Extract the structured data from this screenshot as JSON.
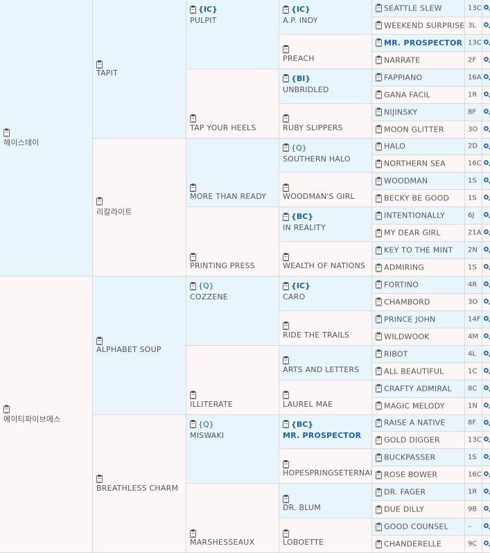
{
  "subject": {
    "sire": "헤이스데이",
    "dam": "에이티파이브에스"
  },
  "gen2": [
    "TAPIT",
    "리칼라이트",
    "ALPHABET SOUP",
    "BREATHLESS CHARM"
  ],
  "gen3": [
    {
      "badge": "{IC}",
      "name": "PULPIT"
    },
    {
      "badge": "",
      "name": "TAP YOUR HEELS"
    },
    {
      "badge": "",
      "name": "MORE THAN READY"
    },
    {
      "badge": "",
      "name": "PRINTING PRESS"
    },
    {
      "badge": "{Q}",
      "name": "COZZENE"
    },
    {
      "badge": "",
      "name": "ILLITERATE"
    },
    {
      "badge": "{Q}",
      "name": "MISWAKI"
    },
    {
      "badge": "",
      "name": "MARSHESSEAUX"
    }
  ],
  "gen4": [
    {
      "badge": "{IC}",
      "name": "A.P. INDY"
    },
    {
      "badge": "",
      "name": "PREACH"
    },
    {
      "badge": "{BI}",
      "name": "UNBRIDLED"
    },
    {
      "badge": "",
      "name": "RUBY SLIPPERS"
    },
    {
      "badge": "{Q}",
      "name": "SOUTHERN HALO"
    },
    {
      "badge": "",
      "name": "WOODMAN'S GIRL"
    },
    {
      "badge": "{BC}",
      "name": "IN REALITY"
    },
    {
      "badge": "",
      "name": "WEALTH OF NATIONS"
    },
    {
      "badge": "{IC}",
      "name": "CARO"
    },
    {
      "badge": "",
      "name": "RIDE THE TRAILS"
    },
    {
      "badge": "",
      "name": "ARTS AND LETTERS"
    },
    {
      "badge": "",
      "name": "LAUREL MAE"
    },
    {
      "badge": "{BC}",
      "name": "MR. PROSPECTOR"
    },
    {
      "badge": "",
      "name": "HOPESPRINGSETERNAL"
    },
    {
      "badge": "",
      "name": "DR. BLUM"
    },
    {
      "badge": "",
      "name": "LOBOETTE"
    }
  ],
  "gen5": [
    {
      "name": "SEATTLE SLEW",
      "code": "13C"
    },
    {
      "name": "WEEKEND SURPRISE",
      "code": "3L"
    },
    {
      "name": "MR. PROSPECTOR",
      "code": "13C"
    },
    {
      "name": "NARRATE",
      "code": "2F"
    },
    {
      "name": "FAPPIANO",
      "code": "16A"
    },
    {
      "name": "GANA FACIL",
      "code": "1R"
    },
    {
      "name": "NIJINSKY",
      "code": "8F"
    },
    {
      "name": "MOON GLITTER",
      "code": "3O"
    },
    {
      "name": "HALO",
      "code": "2D"
    },
    {
      "name": "NORTHERN SEA",
      "code": "16C"
    },
    {
      "name": "WOODMAN",
      "code": "1S"
    },
    {
      "name": "BECKY BE GOOD",
      "code": "1S"
    },
    {
      "name": "INTENTIONALLY",
      "code": "6J"
    },
    {
      "name": "MY DEAR GIRL",
      "code": "21A"
    },
    {
      "name": "KEY TO THE MINT",
      "code": "2N"
    },
    {
      "name": "ADMIRING",
      "code": "1S"
    },
    {
      "name": "FORTINO",
      "code": "4R"
    },
    {
      "name": "CHAMBORD",
      "code": "3O"
    },
    {
      "name": "PRINCE JOHN",
      "code": "14F"
    },
    {
      "name": "WILDWOOK",
      "code": "4M"
    },
    {
      "name": "RIBOT",
      "code": "4L"
    },
    {
      "name": "ALL BEAUTIFUL",
      "code": "1C"
    },
    {
      "name": "CRAFTY ADMIRAL",
      "code": "8C"
    },
    {
      "name": "MAGIC MELODY",
      "code": "1N"
    },
    {
      "name": "RAISE A NATIVE",
      "code": "8F"
    },
    {
      "name": "GOLD DIGGER",
      "code": "13C"
    },
    {
      "name": "BUCKPASSER",
      "code": "1S"
    },
    {
      "name": "ROSE BOWER",
      "code": "16C"
    },
    {
      "name": "DR. FAGER",
      "code": "1R"
    },
    {
      "name": "DUE DILLY",
      "code": "9B"
    },
    {
      "name": "GOOD COUNSEL",
      "code": "–"
    },
    {
      "name": "CHANDERELLE",
      "code": "9C"
    }
  ]
}
